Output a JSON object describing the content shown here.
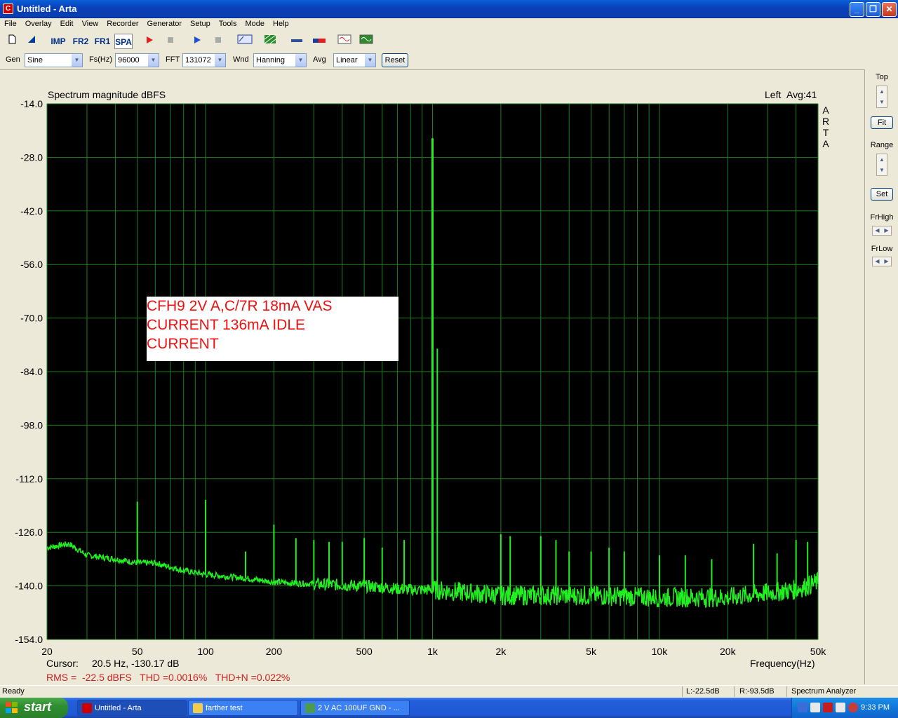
{
  "window": {
    "title": "Untitled - Arta",
    "app_icon_letter": "C"
  },
  "menu": [
    "File",
    "Overlay",
    "Edit",
    "View",
    "Recorder",
    "Generator",
    "Setup",
    "Tools",
    "Mode",
    "Help"
  ],
  "toolbar": {
    "imp": "IMP",
    "fr2": "FR2",
    "fr1": "FR1",
    "spa": "SPA"
  },
  "controls": {
    "gen_label": "Gen",
    "gen_value": "Sine",
    "fs_label": "Fs(Hz)",
    "fs_value": "96000",
    "fft_label": "FFT",
    "fft_value": "131072",
    "wnd_label": "Wnd",
    "wnd_value": "Hanning",
    "avg_label": "Avg",
    "avg_value": "Linear",
    "reset_label": "Reset"
  },
  "side": {
    "top_label": "Top",
    "fit_label": "Fit",
    "range_label": "Range",
    "set_label": "Set",
    "frhigh_label": "FrHigh",
    "frlow_label": "FrLow"
  },
  "annotation": {
    "lines": [
      "CFH9 2V A,C/7R 18mA VAS",
      "CURRENT 136mA IDLE",
      "CURRENT"
    ]
  },
  "readouts": {
    "cursor_label": "Cursor:",
    "cursor_value": "20.5 Hz, -130.17 dB",
    "rms": "RMS =  -22.5 dBFS   THD =0.0016%   THD+N =0.022%"
  },
  "colors": {
    "plot_bg": "#000000",
    "grid": "#1f7f1f",
    "trace": "#22ee22",
    "annotation": "#ee1111",
    "readout_red": "#cc2222"
  },
  "status": {
    "left": "Ready",
    "l_level": "L:-22.5dB",
    "r_level": "R:-93.5dB",
    "mode": "Spectrum Analyzer"
  },
  "taskbar": {
    "start_label": "start",
    "tasks": [
      "Untitled - Arta",
      "farther test",
      "2 V AC 100UF GND - ..."
    ],
    "clock": "9:33 PM"
  },
  "chart_data": {
    "type": "line",
    "title": "Spectrum magnitude dBFS",
    "channel_label": "Left",
    "avg_label": "Avg:41",
    "brand_letters": [
      "A",
      "R",
      "T",
      "A"
    ],
    "xlabel": "Frequency(Hz)",
    "ylabel": "",
    "x_scale": "log",
    "xlim": [
      20,
      50000
    ],
    "ylim": [
      -154,
      -14
    ],
    "x_ticks": [
      20,
      50,
      100,
      200,
      500,
      1000,
      2000,
      5000,
      10000,
      20000,
      50000
    ],
    "x_tick_labels": [
      "20",
      "50",
      "100",
      "200",
      "500",
      "1k",
      "2k",
      "5k",
      "10k",
      "20k",
      "50k"
    ],
    "y_ticks": [
      -14,
      -28,
      -42,
      -56,
      -70,
      -84,
      -98,
      -112,
      -126,
      -140,
      -154
    ],
    "y_tick_labels": [
      "-14.0",
      "-28.0",
      "-42.0",
      "-56.0",
      "-70.0",
      "-84.0",
      "-98.0",
      "-112.0",
      "-126.0",
      "-140.0",
      "-154.0"
    ],
    "grid": true,
    "series": [
      {
        "noise_floor": [
          [
            20,
            -130
          ],
          [
            25,
            -129
          ],
          [
            30,
            -132
          ],
          [
            40,
            -133
          ],
          [
            50,
            -134
          ],
          [
            60,
            -134
          ],
          [
            80,
            -136
          ],
          [
            100,
            -137
          ],
          [
            150,
            -138
          ],
          [
            200,
            -139
          ],
          [
            300,
            -139.5
          ],
          [
            500,
            -140
          ],
          [
            800,
            -141
          ],
          [
            1000,
            -141
          ],
          [
            2000,
            -142.5
          ],
          [
            5000,
            -142.5
          ],
          [
            10000,
            -143
          ],
          [
            20000,
            -143
          ],
          [
            40000,
            -141
          ],
          [
            50000,
            -139
          ]
        ],
        "peaks": [
          [
            50,
            -118
          ],
          [
            100,
            -117.5
          ],
          [
            150,
            -131
          ],
          [
            200,
            -124
          ],
          [
            250,
            -127.5
          ],
          [
            300,
            -128
          ],
          [
            350,
            -128.5
          ],
          [
            400,
            -128.5
          ],
          [
            500,
            -127.5
          ],
          [
            600,
            -130
          ],
          [
            750,
            -128
          ],
          [
            1000,
            -23
          ],
          [
            1050,
            -78
          ],
          [
            2000,
            -126.5
          ],
          [
            2200,
            -127
          ],
          [
            3000,
            -127
          ],
          [
            3500,
            -128
          ],
          [
            4000,
            -131
          ],
          [
            5000,
            -131
          ],
          [
            6000,
            -130
          ],
          [
            7000,
            -131
          ],
          [
            10000,
            -132
          ],
          [
            13000,
            -132
          ],
          [
            17000,
            -133
          ],
          [
            26000,
            -129
          ],
          [
            33000,
            -131.5
          ],
          [
            40000,
            -128
          ],
          [
            45000,
            -128.5
          ]
        ]
      }
    ]
  }
}
